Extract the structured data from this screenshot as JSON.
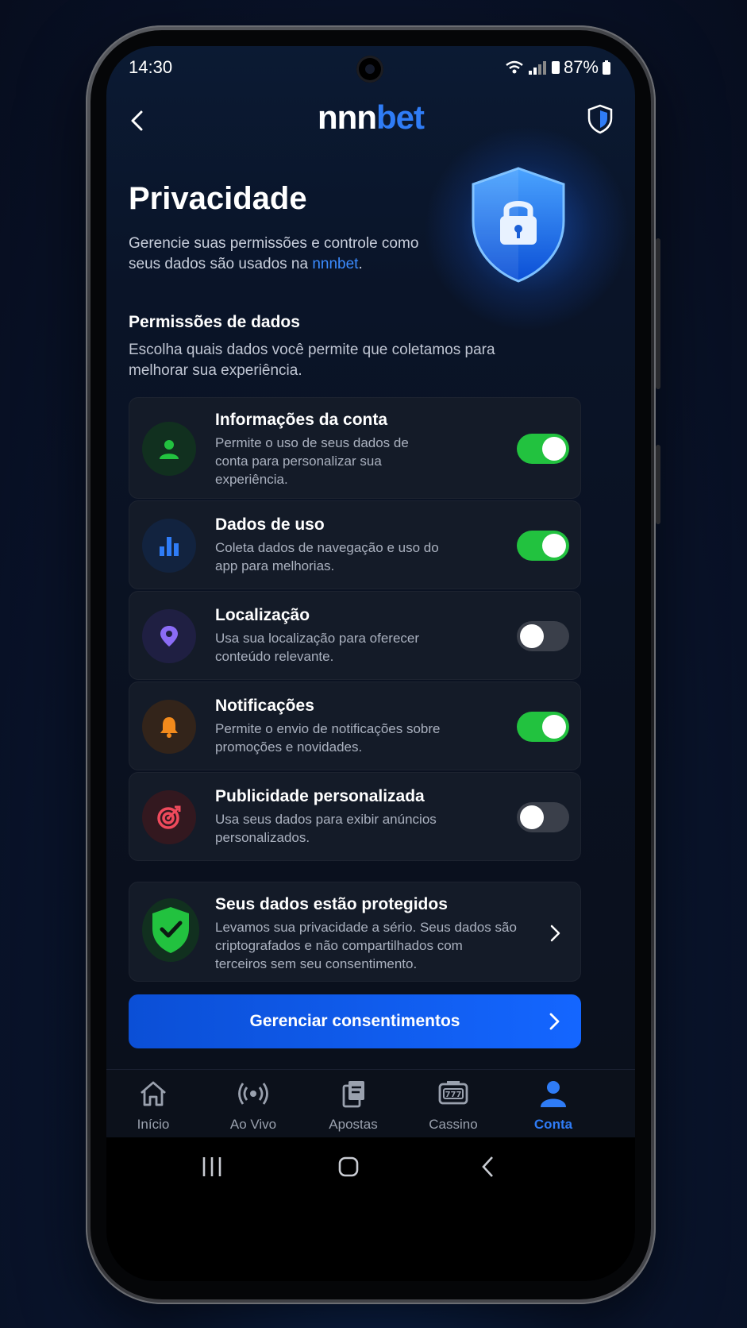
{
  "status_bar": {
    "time": "14:30",
    "battery": "87%"
  },
  "header": {
    "logo_part1": "nnn",
    "logo_part2": "bet",
    "back_icon": "chevron-left-icon",
    "right_icon": "shield-icon"
  },
  "hero": {
    "title": "Privacidade",
    "subtitle_before": "Gerencie suas permissões e controle como seus dados são usados na ",
    "subtitle_brand": "nnnbet",
    "subtitle_after": "."
  },
  "permissions": {
    "title": "Permissões de dados",
    "description": "Escolha quais dados você permite que coletamos para melhorar sua experiência.",
    "items": [
      {
        "title": "Informações da conta",
        "description": "Permite o uso de seus dados de conta para personalizar sua experiência.",
        "enabled": true,
        "icon": "user-icon",
        "color": "#22c23f"
      },
      {
        "title": "Dados de uso",
        "description": "Coleta dados de navegação e uso do app para melhorias.",
        "enabled": true,
        "icon": "bar-chart-icon",
        "color": "#2f7cf6"
      },
      {
        "title": "Localização",
        "description": "Usa sua localização para oferecer conteúdo relevante.",
        "enabled": false,
        "icon": "location-pin-icon",
        "color": "#8b6cf6"
      },
      {
        "title": "Notificações",
        "description": "Permite o envio de notificações sobre promoções e novidades.",
        "enabled": true,
        "icon": "bell-icon",
        "color": "#f28a1c"
      },
      {
        "title": "Publicidade personalizada",
        "description": "Usa seus dados para exibir anúncios personalizados.",
        "enabled": false,
        "icon": "target-icon",
        "color": "#ef4a5c"
      }
    ]
  },
  "protection": {
    "title": "Seus dados estão protegidos",
    "description": "Levamos sua privacidade a sério. Seus dados são criptografados e não compartilhados com terceiros sem seu consentimento."
  },
  "cta": {
    "label": "Gerenciar consentimentos"
  },
  "tabs": [
    {
      "label": "Início",
      "icon": "home-icon",
      "active": false
    },
    {
      "label": "Ao Vivo",
      "icon": "live-broadcast-icon",
      "active": false
    },
    {
      "label": "Apostas",
      "icon": "bet-slip-icon",
      "active": false
    },
    {
      "label": "Cassino",
      "icon": "slot-machine-icon",
      "active": false
    },
    {
      "label": "Conta",
      "icon": "account-icon",
      "active": true
    }
  ],
  "colors": {
    "accent": "#2f7cf6",
    "toggle_on": "#22c23f",
    "background": "#0a1120"
  }
}
